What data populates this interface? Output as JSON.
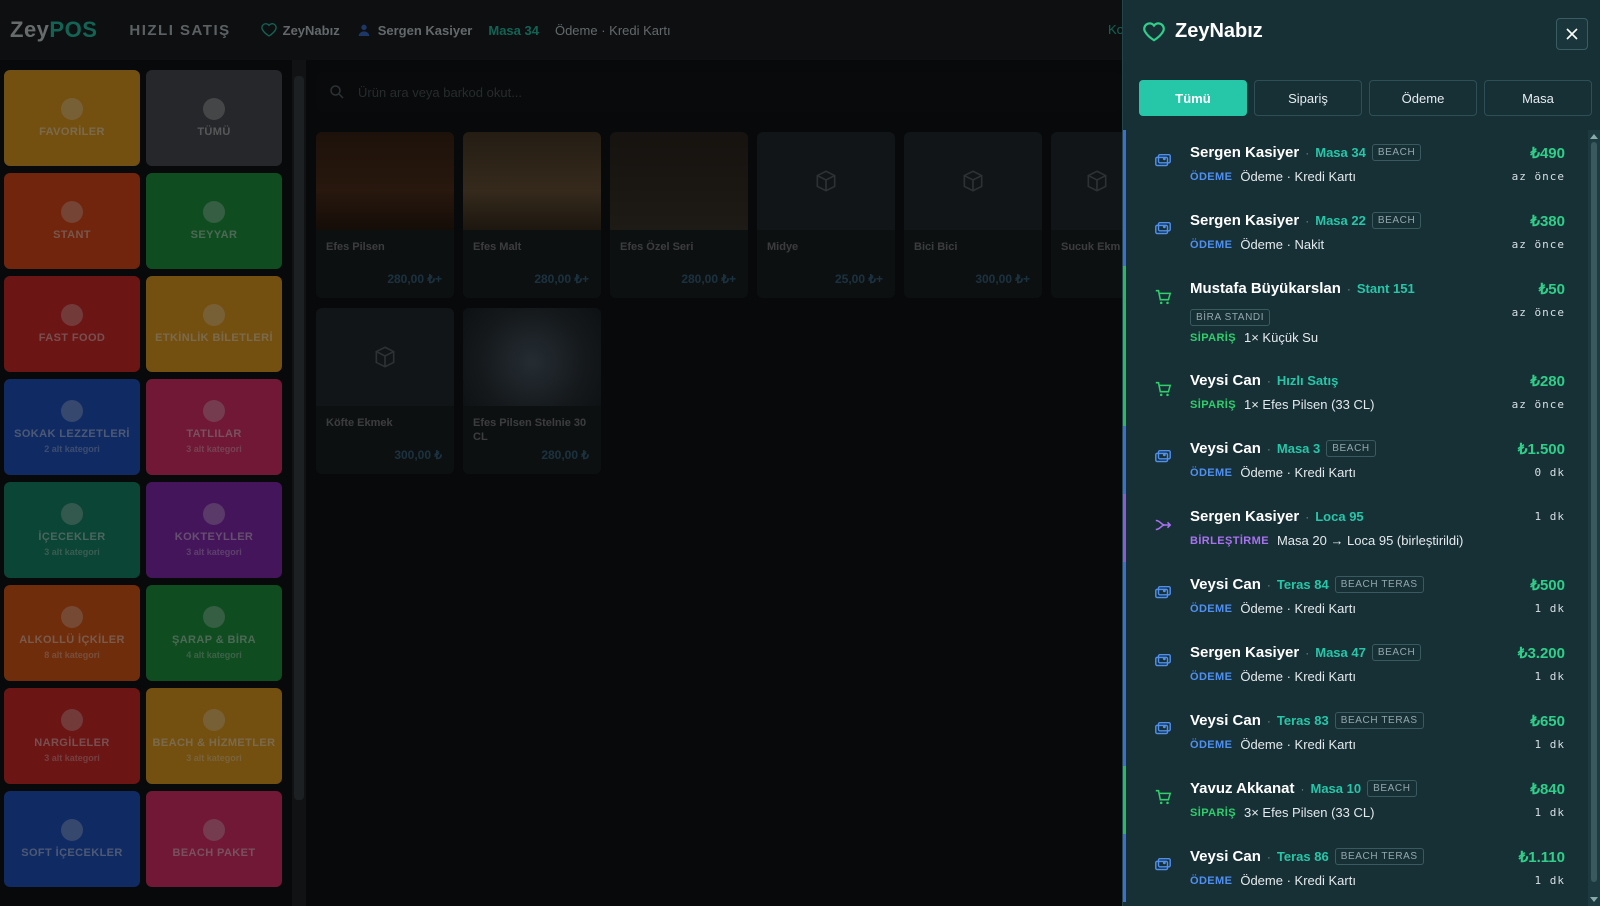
{
  "topbar": {
    "logo_main": "Zey",
    "logo_accent": "POS",
    "mode": "HIZLI SATIŞ",
    "branch": "ZeyNabız",
    "cashier": "Sergen Kasiyer",
    "table": "Masa 34",
    "payment": "Ödeme · Kredi Kartı",
    "cut_text": "Ko"
  },
  "categories": [
    {
      "label": "FAVORİLER",
      "sub": "",
      "color": "#e8a020",
      "selected": true,
      "icon": "star-icon"
    },
    {
      "label": "TÜMÜ",
      "sub": "",
      "color": "#4a4f55",
      "selected": false,
      "icon": "grid-icon"
    },
    {
      "label": "STANT",
      "sub": "",
      "color": "#e04a18",
      "selected": false,
      "icon": "box-icon"
    },
    {
      "label": "SEYYAR",
      "sub": "",
      "color": "#1f9a42",
      "selected": false,
      "icon": "box-icon"
    },
    {
      "label": "FAST FOOD",
      "sub": "",
      "color": "#d92a2a",
      "selected": false,
      "icon": "box-icon"
    },
    {
      "label": "ETKİNLİK BİLETLERİ",
      "sub": "",
      "color": "#e8a020",
      "selected": false,
      "icon": "ticket-icon"
    },
    {
      "label": "SOKAK LEZZETLERİ",
      "sub": "2 alt kategori",
      "color": "#2055c8",
      "selected": false,
      "icon": "meat-icon"
    },
    {
      "label": "TATLILAR",
      "sub": "3 alt kategori",
      "color": "#e0306a",
      "selected": false,
      "icon": "cake-icon"
    },
    {
      "label": "İÇECEKLER",
      "sub": "3 alt kategori",
      "color": "#168a6a",
      "selected": false,
      "icon": "cup-icon"
    },
    {
      "label": "KOKTEYLLER",
      "sub": "3 alt kategori",
      "color": "#8a2ab8",
      "selected": false,
      "icon": "cocktail-icon"
    },
    {
      "label": "ALKOLLÜ İÇKİLER",
      "sub": "8 alt kategori",
      "color": "#e05a18",
      "selected": false,
      "icon": "wine-icon"
    },
    {
      "label": "ŞARAP & BİRA",
      "sub": "4 alt kategori",
      "color": "#1f9a42",
      "selected": false,
      "icon": "wine-icon"
    },
    {
      "label": "NARGİLELER",
      "sub": "3 alt kategori",
      "color": "#d92a2a",
      "selected": false,
      "icon": "box-icon"
    },
    {
      "label": "BEACH & HİZMETLER",
      "sub": "3 alt kategori",
      "color": "#e8a020",
      "selected": false,
      "icon": "meat-icon"
    },
    {
      "label": "SOFT İÇECEKLER",
      "sub": "",
      "color": "#2055c8",
      "selected": false,
      "icon": "cup-icon"
    },
    {
      "label": "BEACH PAKET",
      "sub": "",
      "color": "#e0306a",
      "selected": false,
      "icon": "meat-icon"
    }
  ],
  "search": {
    "placeholder": "Ürün ara veya barkod okut..."
  },
  "products": [
    {
      "name": "Efes Pilsen",
      "price": "280,00 ₺+",
      "img": "photo1"
    },
    {
      "name": "Efes Malt",
      "price": "280,00 ₺+",
      "img": "photo2"
    },
    {
      "name": "Efes Özel Seri",
      "price": "280,00 ₺+",
      "img": "photo3"
    },
    {
      "name": "Midye",
      "price": "25,00 ₺+",
      "img": ""
    },
    {
      "name": "Bici Bici",
      "price": "300,00 ₺+",
      "img": ""
    },
    {
      "name": "Sucuk Ekm",
      "price": "",
      "img": ""
    },
    {
      "name": "Köfte Ekmek",
      "price": "300,00 ₺",
      "img": ""
    },
    {
      "name": "Efes Pilsen Stelnie 30 CL",
      "price": "280,00 ₺",
      "img": "photo4"
    }
  ],
  "panel": {
    "title": "ZeyNabız",
    "tabs": [
      "Tümü",
      "Sipariş",
      "Ödeme",
      "Masa"
    ],
    "active_tab": "Tümü",
    "feed": [
      {
        "kind": "pay",
        "who": "Sergen Kasiyer",
        "loc": "Masa 34",
        "tag": "BEACH",
        "kind_label": "ÖDEME",
        "detail": "Ödeme · Kredi Kartı",
        "amount": "₺490",
        "time": "az önce"
      },
      {
        "kind": "pay",
        "who": "Sergen Kasiyer",
        "loc": "Masa 22",
        "tag": "BEACH",
        "kind_label": "ÖDEME",
        "detail": "Ödeme · Nakit",
        "amount": "₺380",
        "time": "az önce"
      },
      {
        "kind": "ord",
        "who": "Mustafa Büyükarslan",
        "loc": "Stant 151",
        "tag": "",
        "subtag": "BİRA STANDI",
        "kind_label": "SİPARİŞ",
        "detail": "1× Küçük Su",
        "amount": "₺50",
        "time": "az önce"
      },
      {
        "kind": "ord",
        "who": "Veysi Can",
        "loc": "Hızlı Satış",
        "tag": "",
        "kind_label": "SİPARİŞ",
        "detail": "1× Efes Pilsen (33 CL)",
        "amount": "₺280",
        "time": "az önce"
      },
      {
        "kind": "pay",
        "who": "Veysi Can",
        "loc": "Masa 3",
        "tag": "BEACH",
        "kind_label": "ÖDEME",
        "detail": "Ödeme · Kredi Kartı",
        "amount": "₺1.500",
        "time": "0 dk"
      },
      {
        "kind": "mrg",
        "who": "Sergen Kasiyer",
        "loc": "Loca 95",
        "tag": "",
        "kind_label": "BİRLEŞTİRME",
        "detail": "Masa 20 → Loca 95 (birleştirildi)",
        "amount": "",
        "time": "1 dk"
      },
      {
        "kind": "pay",
        "who": "Veysi Can",
        "loc": "Teras 84",
        "tag": "BEACH TERAS",
        "kind_label": "ÖDEME",
        "detail": "Ödeme · Kredi Kartı",
        "amount": "₺500",
        "time": "1 dk"
      },
      {
        "kind": "pay",
        "who": "Sergen Kasiyer",
        "loc": "Masa 47",
        "tag": "BEACH",
        "kind_label": "ÖDEME",
        "detail": "Ödeme · Kredi Kartı",
        "amount": "₺3.200",
        "time": "1 dk"
      },
      {
        "kind": "pay",
        "who": "Veysi Can",
        "loc": "Teras 83",
        "tag": "BEACH TERAS",
        "kind_label": "ÖDEME",
        "detail": "Ödeme · Kredi Kartı",
        "amount": "₺650",
        "time": "1 dk"
      },
      {
        "kind": "ord",
        "who": "Yavuz Akkanat",
        "loc": "Masa 10",
        "tag": "BEACH",
        "kind_label": "SİPARİŞ",
        "detail": "3× Efes Pilsen (33 CL)",
        "amount": "₺840",
        "time": "1 dk"
      },
      {
        "kind": "pay",
        "who": "Veysi Can",
        "loc": "Teras 86",
        "tag": "BEACH TERAS",
        "kind_label": "ÖDEME",
        "detail": "Ödeme · Kredi Kartı",
        "amount": "₺1.110",
        "time": "1 dk"
      }
    ]
  },
  "colors": {
    "accent": "#26c6a8",
    "payment": "#4f8ff0",
    "order": "#2fcf6b",
    "merge": "#a872f0",
    "amount": "#2fcf8a"
  }
}
